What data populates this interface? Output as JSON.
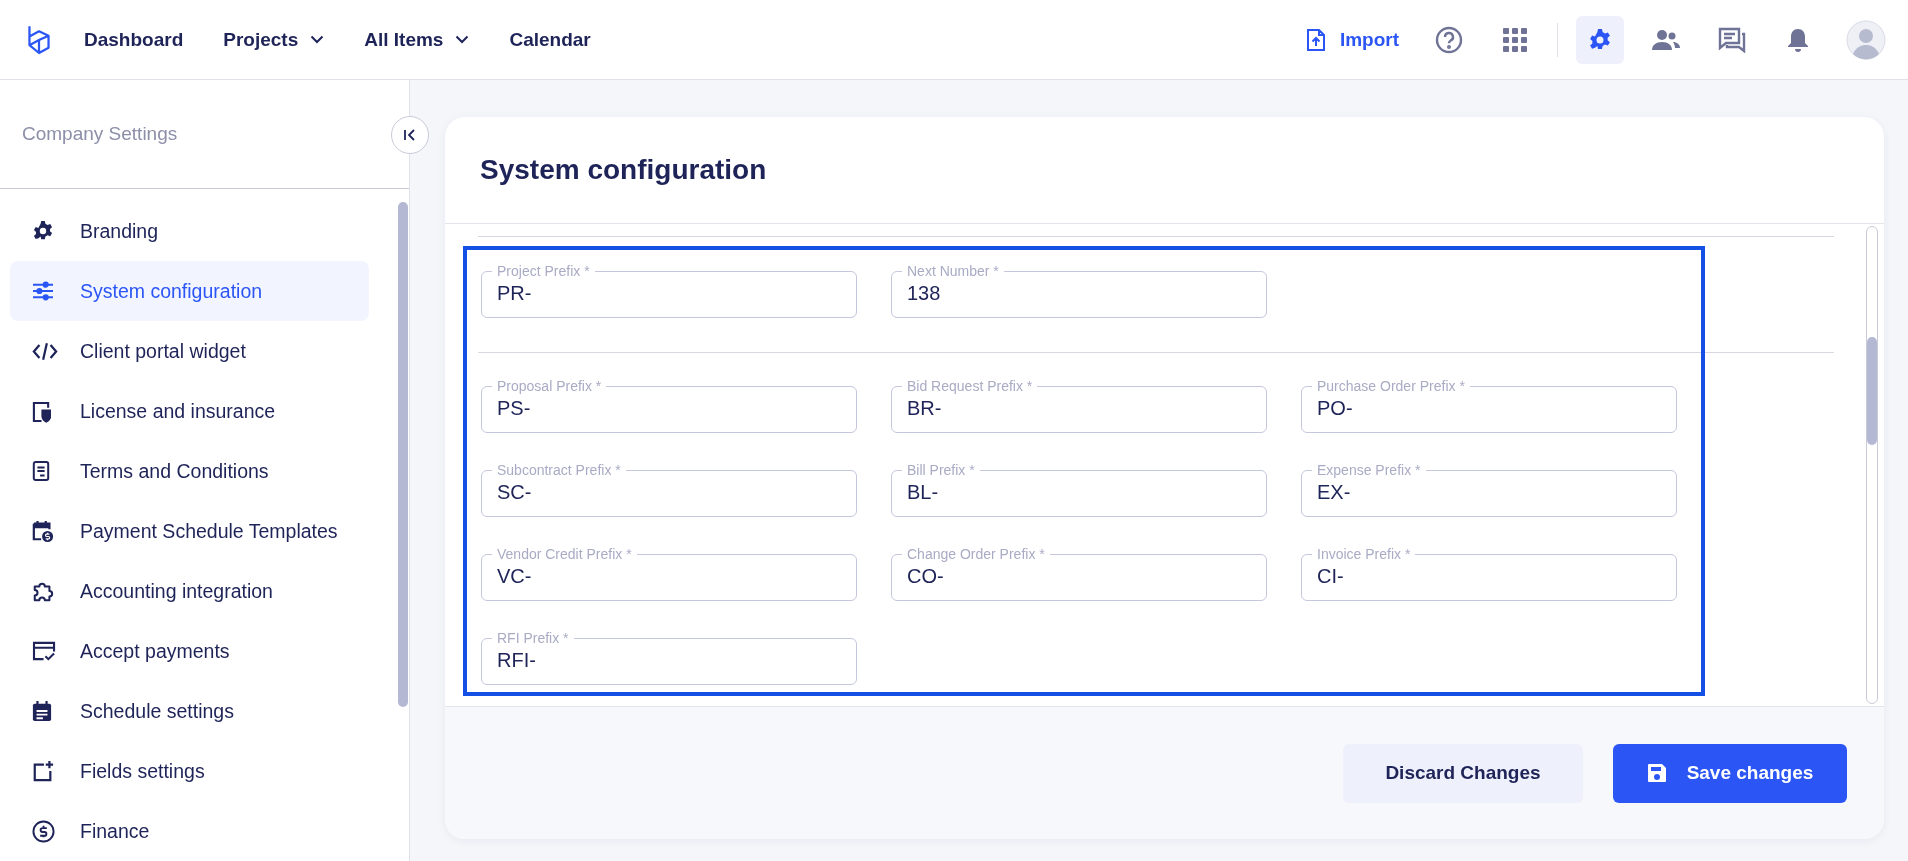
{
  "top_nav": {
    "items": [
      {
        "label": "Dashboard",
        "dropdown": false
      },
      {
        "label": "Projects",
        "dropdown": true
      },
      {
        "label": "All Items",
        "dropdown": true
      },
      {
        "label": "Calendar",
        "dropdown": false
      }
    ],
    "import_button": "Import",
    "toolbar_icons": [
      {
        "kind": "help",
        "selected": false
      },
      {
        "kind": "apps",
        "selected": false
      },
      {
        "kind": "settings",
        "selected": true
      },
      {
        "kind": "team",
        "selected": false
      },
      {
        "kind": "messages",
        "selected": false
      },
      {
        "kind": "notifications",
        "selected": false
      }
    ]
  },
  "sidebar": {
    "title": "Company Settings",
    "items": [
      {
        "kind": "gear",
        "label": "Branding",
        "selected": false
      },
      {
        "kind": "sliders",
        "label": "System configuration",
        "selected": true
      },
      {
        "kind": "code",
        "label": "Client portal widget",
        "selected": false
      },
      {
        "kind": "shield",
        "label": "License and insurance",
        "selected": false
      },
      {
        "kind": "document",
        "label": "Terms and Conditions",
        "selected": false
      },
      {
        "kind": "calendar-dollar",
        "label": "Payment Schedule Templates",
        "selected": false
      },
      {
        "kind": "puzzle",
        "label": "Accounting integration",
        "selected": false
      },
      {
        "kind": "card",
        "label": "Accept payments",
        "selected": false
      },
      {
        "kind": "calendar",
        "label": "Schedule settings",
        "selected": false
      },
      {
        "kind": "add-field",
        "label": "Fields settings",
        "selected": false
      },
      {
        "kind": "dollar",
        "label": "Finance",
        "selected": false
      }
    ]
  },
  "card": {
    "title": "System configuration",
    "field_groups": [
      [
        {
          "label": "Project Prefix *",
          "value": "PR-"
        },
        {
          "label": "Next Number *",
          "value": "138"
        }
      ],
      [
        {
          "label": "Proposal Prefix *",
          "value": "PS-"
        },
        {
          "label": "Bid Request Prefix *",
          "value": "BR-"
        },
        {
          "label": "Purchase Order Prefix *",
          "value": "PO-"
        },
        {
          "label": "Subcontract Prefix *",
          "value": "SC-"
        },
        {
          "label": "Bill Prefix *",
          "value": "BL-"
        },
        {
          "label": "Expense Prefix *",
          "value": "EX-"
        },
        {
          "label": "Vendor Credit Prefix *",
          "value": "VC-"
        },
        {
          "label": "Change Order Prefix *",
          "value": "CO-"
        },
        {
          "label": "Invoice Prefix *",
          "value": "CI-"
        },
        {
          "label": "RFI Prefix *",
          "value": "RFI-"
        }
      ]
    ],
    "discard_button": "Discard Changes",
    "save_button": "Save changes"
  }
}
